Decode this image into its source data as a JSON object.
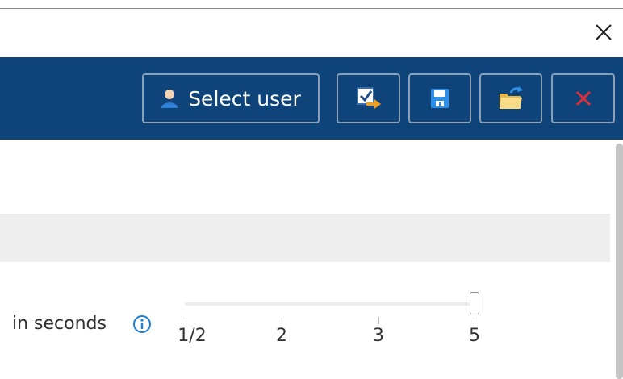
{
  "window": {
    "close_icon": "close-icon"
  },
  "toolbar": {
    "background": "#0e447a",
    "select_user_label": "Select user",
    "buttons": [
      {
        "name": "select-user",
        "icon": "user-icon"
      },
      {
        "name": "export",
        "icon": "export-icon"
      },
      {
        "name": "save",
        "icon": "save-icon"
      },
      {
        "name": "open",
        "icon": "open-folder-icon"
      },
      {
        "name": "delete",
        "icon": "delete-icon",
        "color": "#d9303a"
      }
    ]
  },
  "setting": {
    "label": "in seconds",
    "info_icon": "info-icon",
    "info_color": "#1a7fd6"
  },
  "slider": {
    "ticks": [
      "1/2",
      "2",
      "3",
      "5"
    ],
    "selected": "5"
  }
}
